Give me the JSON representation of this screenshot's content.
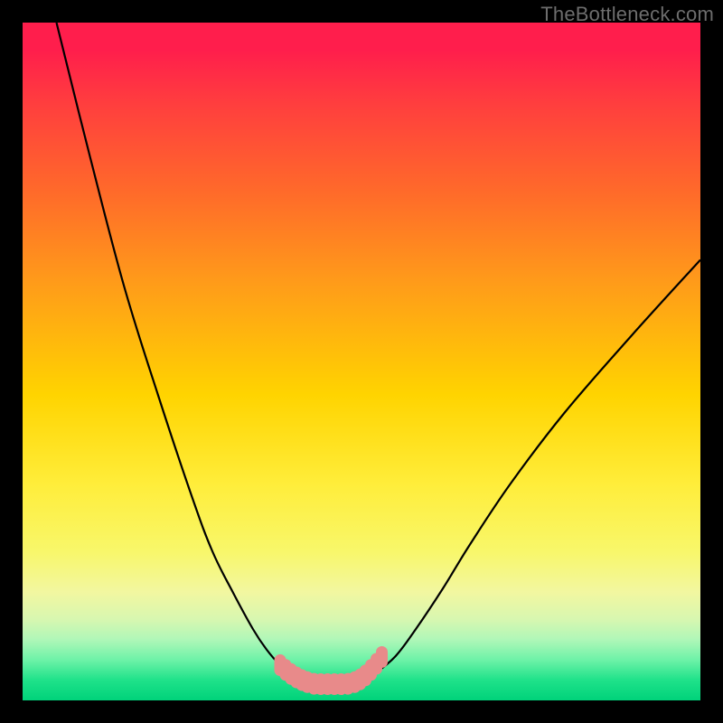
{
  "watermark": "TheBottleneck.com",
  "chart_data": {
    "type": "line",
    "title": "",
    "xlabel": "",
    "ylabel": "",
    "xlim": [
      0,
      100
    ],
    "ylim": [
      0,
      100
    ],
    "series": [
      {
        "name": "left-branch",
        "x": [
          5,
          10,
          15,
          20,
          25,
          28,
          31,
          34,
          36,
          38,
          40,
          41,
          42,
          43
        ],
        "y": [
          100,
          80,
          61,
          45,
          30,
          22,
          16,
          10.5,
          7.5,
          5.2,
          3.6,
          3.0,
          2.6,
          2.4
        ]
      },
      {
        "name": "right-branch",
        "x": [
          48,
          50,
          52,
          55,
          58,
          62,
          66,
          72,
          80,
          90,
          100
        ],
        "y": [
          2.4,
          2.9,
          4.0,
          6.5,
          10.5,
          16.5,
          23,
          32,
          42.5,
          54,
          65
        ]
      }
    ],
    "ideal_segment": {
      "name": "ideal-zone-markers",
      "color": "#e88a8a",
      "points": [
        {
          "x": 38.0,
          "y": 5.2
        },
        {
          "x": 38.8,
          "y": 4.5
        },
        {
          "x": 39.6,
          "y": 3.9
        },
        {
          "x": 40.4,
          "y": 3.4
        },
        {
          "x": 41.2,
          "y": 3.0
        },
        {
          "x": 42.0,
          "y": 2.7
        },
        {
          "x": 43.0,
          "y": 2.45
        },
        {
          "x": 44.0,
          "y": 2.4
        },
        {
          "x": 45.0,
          "y": 2.4
        },
        {
          "x": 46.0,
          "y": 2.4
        },
        {
          "x": 47.0,
          "y": 2.4
        },
        {
          "x": 48.0,
          "y": 2.45
        },
        {
          "x": 49.0,
          "y": 2.7
        },
        {
          "x": 49.8,
          "y": 3.1
        },
        {
          "x": 50.6,
          "y": 3.7
        },
        {
          "x": 51.4,
          "y": 4.5
        },
        {
          "x": 52.2,
          "y": 5.4
        },
        {
          "x": 53.0,
          "y": 6.4
        }
      ]
    }
  }
}
